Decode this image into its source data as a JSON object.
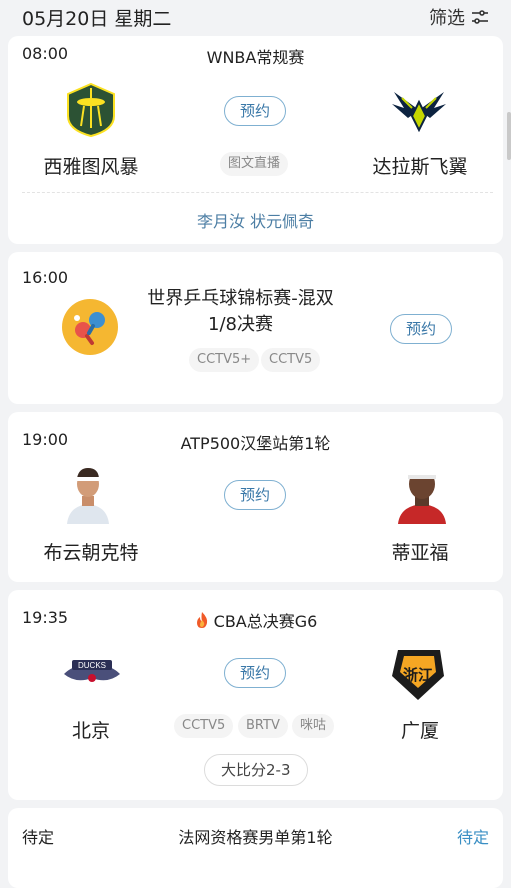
{
  "header": {
    "date": "05月20日 星期二",
    "filter_label": "筛选"
  },
  "matches": [
    {
      "time": "08:00",
      "title": "WNBA常规赛",
      "home": "西雅图风暴",
      "away": "达拉斯飞翼",
      "button": "预约",
      "channels": [
        "图文直播"
      ],
      "commentators": "李月汝 状元佩奇"
    },
    {
      "time": "16:00",
      "title_line1": "世界乒乓球锦标赛-混双",
      "title_line2": "1/8决赛",
      "button": "预约",
      "channels": [
        "CCTV5+",
        "CCTV5"
      ]
    },
    {
      "time": "19:00",
      "title": "ATP500汉堡站第1轮",
      "home": "布云朝克特",
      "away": "蒂亚福",
      "button": "预约"
    },
    {
      "time": "19:35",
      "title": "CBA总决赛G6",
      "home": "北京",
      "away": "广厦",
      "button": "预约",
      "channels": [
        "CCTV5",
        "BRTV",
        "咪咕"
      ],
      "score": "大比分2-3",
      "away_logo_text": "浙江"
    },
    {
      "time": "待定",
      "title": "法网资格赛男单第1轮",
      "status": "待定"
    }
  ],
  "colors": {
    "accent": "#3a78a8",
    "link": "#4c7ea4",
    "background": "#f2f3f5"
  }
}
